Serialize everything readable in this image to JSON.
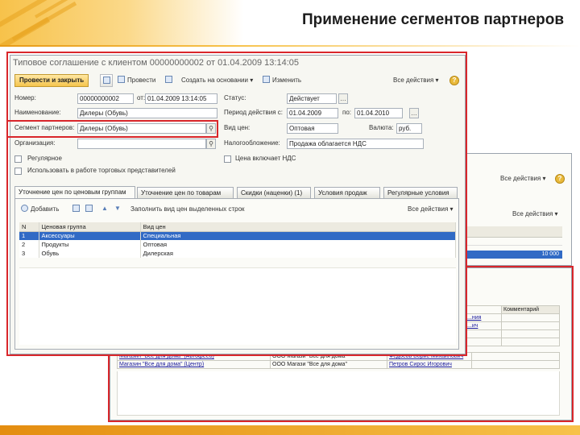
{
  "slide": {
    "title": "Применение сегментов партнеров"
  },
  "back_window": {
    "all_actions": "Все действия ▾",
    "all_actions_2": "Все действия ▾",
    "selected_value": "10 000"
  },
  "back_table": {
    "comment_header": "Комментарий",
    "rows": [
      {
        "c1": "Магазин \"Все для дома\" (Автофеео)",
        "c2": "ООО Магази \"Все для дома\"",
        "c3": "Федосов Борис Михайлович"
      },
      {
        "c1": "Магазин \"Все для дома\" (Центр)",
        "c2": "ООО Магази \"Все для дома\"",
        "c3": "Петров Сирос Игорович"
      }
    ],
    "partial_right": [
      "...ния",
      "...ич",
      "...ич",
      "...ич",
      "...ич",
      "...ич"
    ]
  },
  "form": {
    "title": "Типовое соглашение с клиентом 00000000002 от 01.04.2009 13:14:05",
    "toolbar": {
      "post_close": "Провести и закрыть",
      "post": "Провести",
      "create_basis": "Создать на основании ▾",
      "edit": "Изменить",
      "all_actions": "Все действия ▾"
    },
    "fields": {
      "number_label": "Номер:",
      "number_value": "00000000002",
      "from_label": "от:",
      "from_value": "01.04.2009 13:14:05",
      "status_label": "Статус:",
      "status_value": "Действует",
      "name_label": "Наименование:",
      "name_value": "Дилеры (Обувь)",
      "period_label": "Период действия с:",
      "period_from": "01.04.2009",
      "period_to_label": "по:",
      "period_to": "01.04.2010",
      "segment_label": "Сегмент партнеров:",
      "segment_value": "Дилеры (Обувь)",
      "price_type_label": "Вид цен:",
      "price_type_value": "Оптовая",
      "currency_label": "Валюта:",
      "currency_value": "руб.",
      "org_label": "Организация:",
      "org_value": "",
      "tax_label": "Налогообложение:",
      "tax_value": "Продажа облагается НДС",
      "regular_label": "Регулярное",
      "vat_included_label": "Цена включает НДС",
      "use_in_work_label": "Использовать в работе торговых представителей"
    },
    "tabs": [
      "Уточнение цен по ценовым группам",
      "Уточнение цен по товарам",
      "Скидки (наценки) (1)",
      "Условия продаж",
      "Регулярные условия"
    ],
    "grid_toolbar": {
      "add": "Добавить",
      "fill": "Заполнить вид цен выделенных строк",
      "all_actions": "Все действия ▾"
    },
    "grid": {
      "headers": [
        "N",
        "Ценовая группа",
        "Вид цен"
      ],
      "rows": [
        {
          "n": "1",
          "group": "Аксессуары",
          "price": "Специальная"
        },
        {
          "n": "2",
          "group": "Продукты",
          "price": "Оптовая"
        },
        {
          "n": "3",
          "group": "Обувь",
          "price": "Дилерская"
        }
      ]
    }
  }
}
